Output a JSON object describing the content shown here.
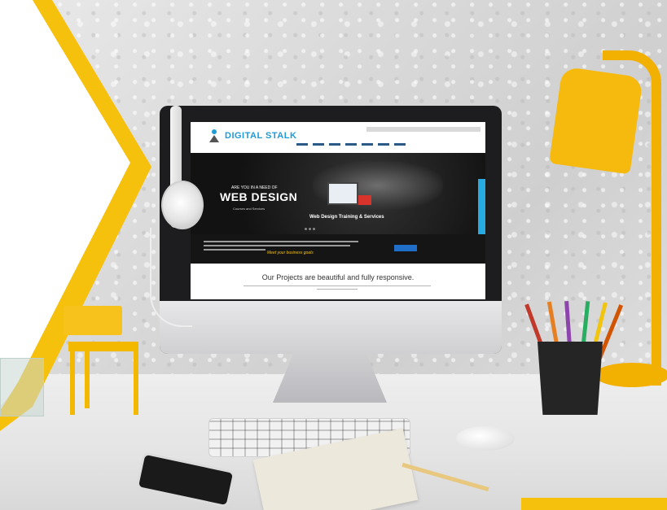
{
  "site": {
    "logo_text": "DIGITAL STALK",
    "hero_pre": "ARE YOU IN A NEED OF",
    "hero_title": "WEB DESIGN",
    "hero_sub": "Courses and Services",
    "hero_caption": "Web Design Training & Services",
    "band_tagline": "Meet your business goals",
    "projects_title": "Our Projects are beautiful and fully responsive."
  },
  "colors": {
    "accent_yellow": "#f6c10c",
    "brand_blue": "#1f9bd7",
    "cta_blue": "#1f6fc9",
    "hero_dark": "#121212"
  },
  "icons": {
    "logo": "person-logo-icon",
    "lamp": "desk-lamp-icon"
  }
}
